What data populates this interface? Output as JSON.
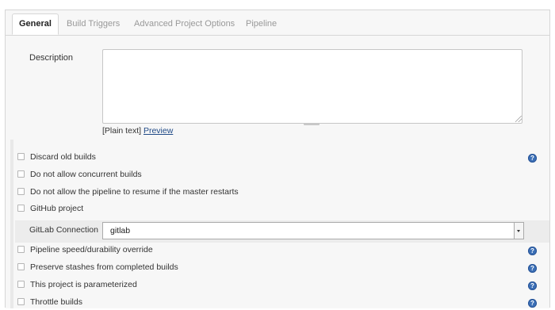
{
  "tabs": [
    {
      "label": "General",
      "active": true
    },
    {
      "label": "Build Triggers",
      "active": false
    },
    {
      "label": "Advanced Project Options",
      "active": false
    },
    {
      "label": "Pipeline",
      "active": false
    }
  ],
  "description": {
    "label": "Description",
    "value": "",
    "plain_text": "[Plain text]",
    "preview_link": "Preview"
  },
  "options": [
    {
      "label": "Discard old builds",
      "checked": false,
      "help": true
    },
    {
      "label": "Do not allow concurrent builds",
      "checked": false,
      "help": false
    },
    {
      "label": "Do not allow the pipeline to resume if the master restarts",
      "checked": false,
      "help": false
    },
    {
      "label": "GitHub project",
      "checked": false,
      "help": false
    }
  ],
  "gitlab_connection": {
    "label": "GitLab Connection",
    "selected": "gitlab"
  },
  "options_after": [
    {
      "label": "Pipeline speed/durability override",
      "checked": false,
      "help": true
    },
    {
      "label": "Preserve stashes from completed builds",
      "checked": false,
      "help": true
    },
    {
      "label": "This project is parameterized",
      "checked": false,
      "help": true
    },
    {
      "label": "Throttle builds",
      "checked": false,
      "help": true
    }
  ],
  "help_icon_text": "?",
  "colors": {
    "background": "#f7f7f7",
    "help_icon": "#3b6fb6",
    "link": "#204a87"
  }
}
